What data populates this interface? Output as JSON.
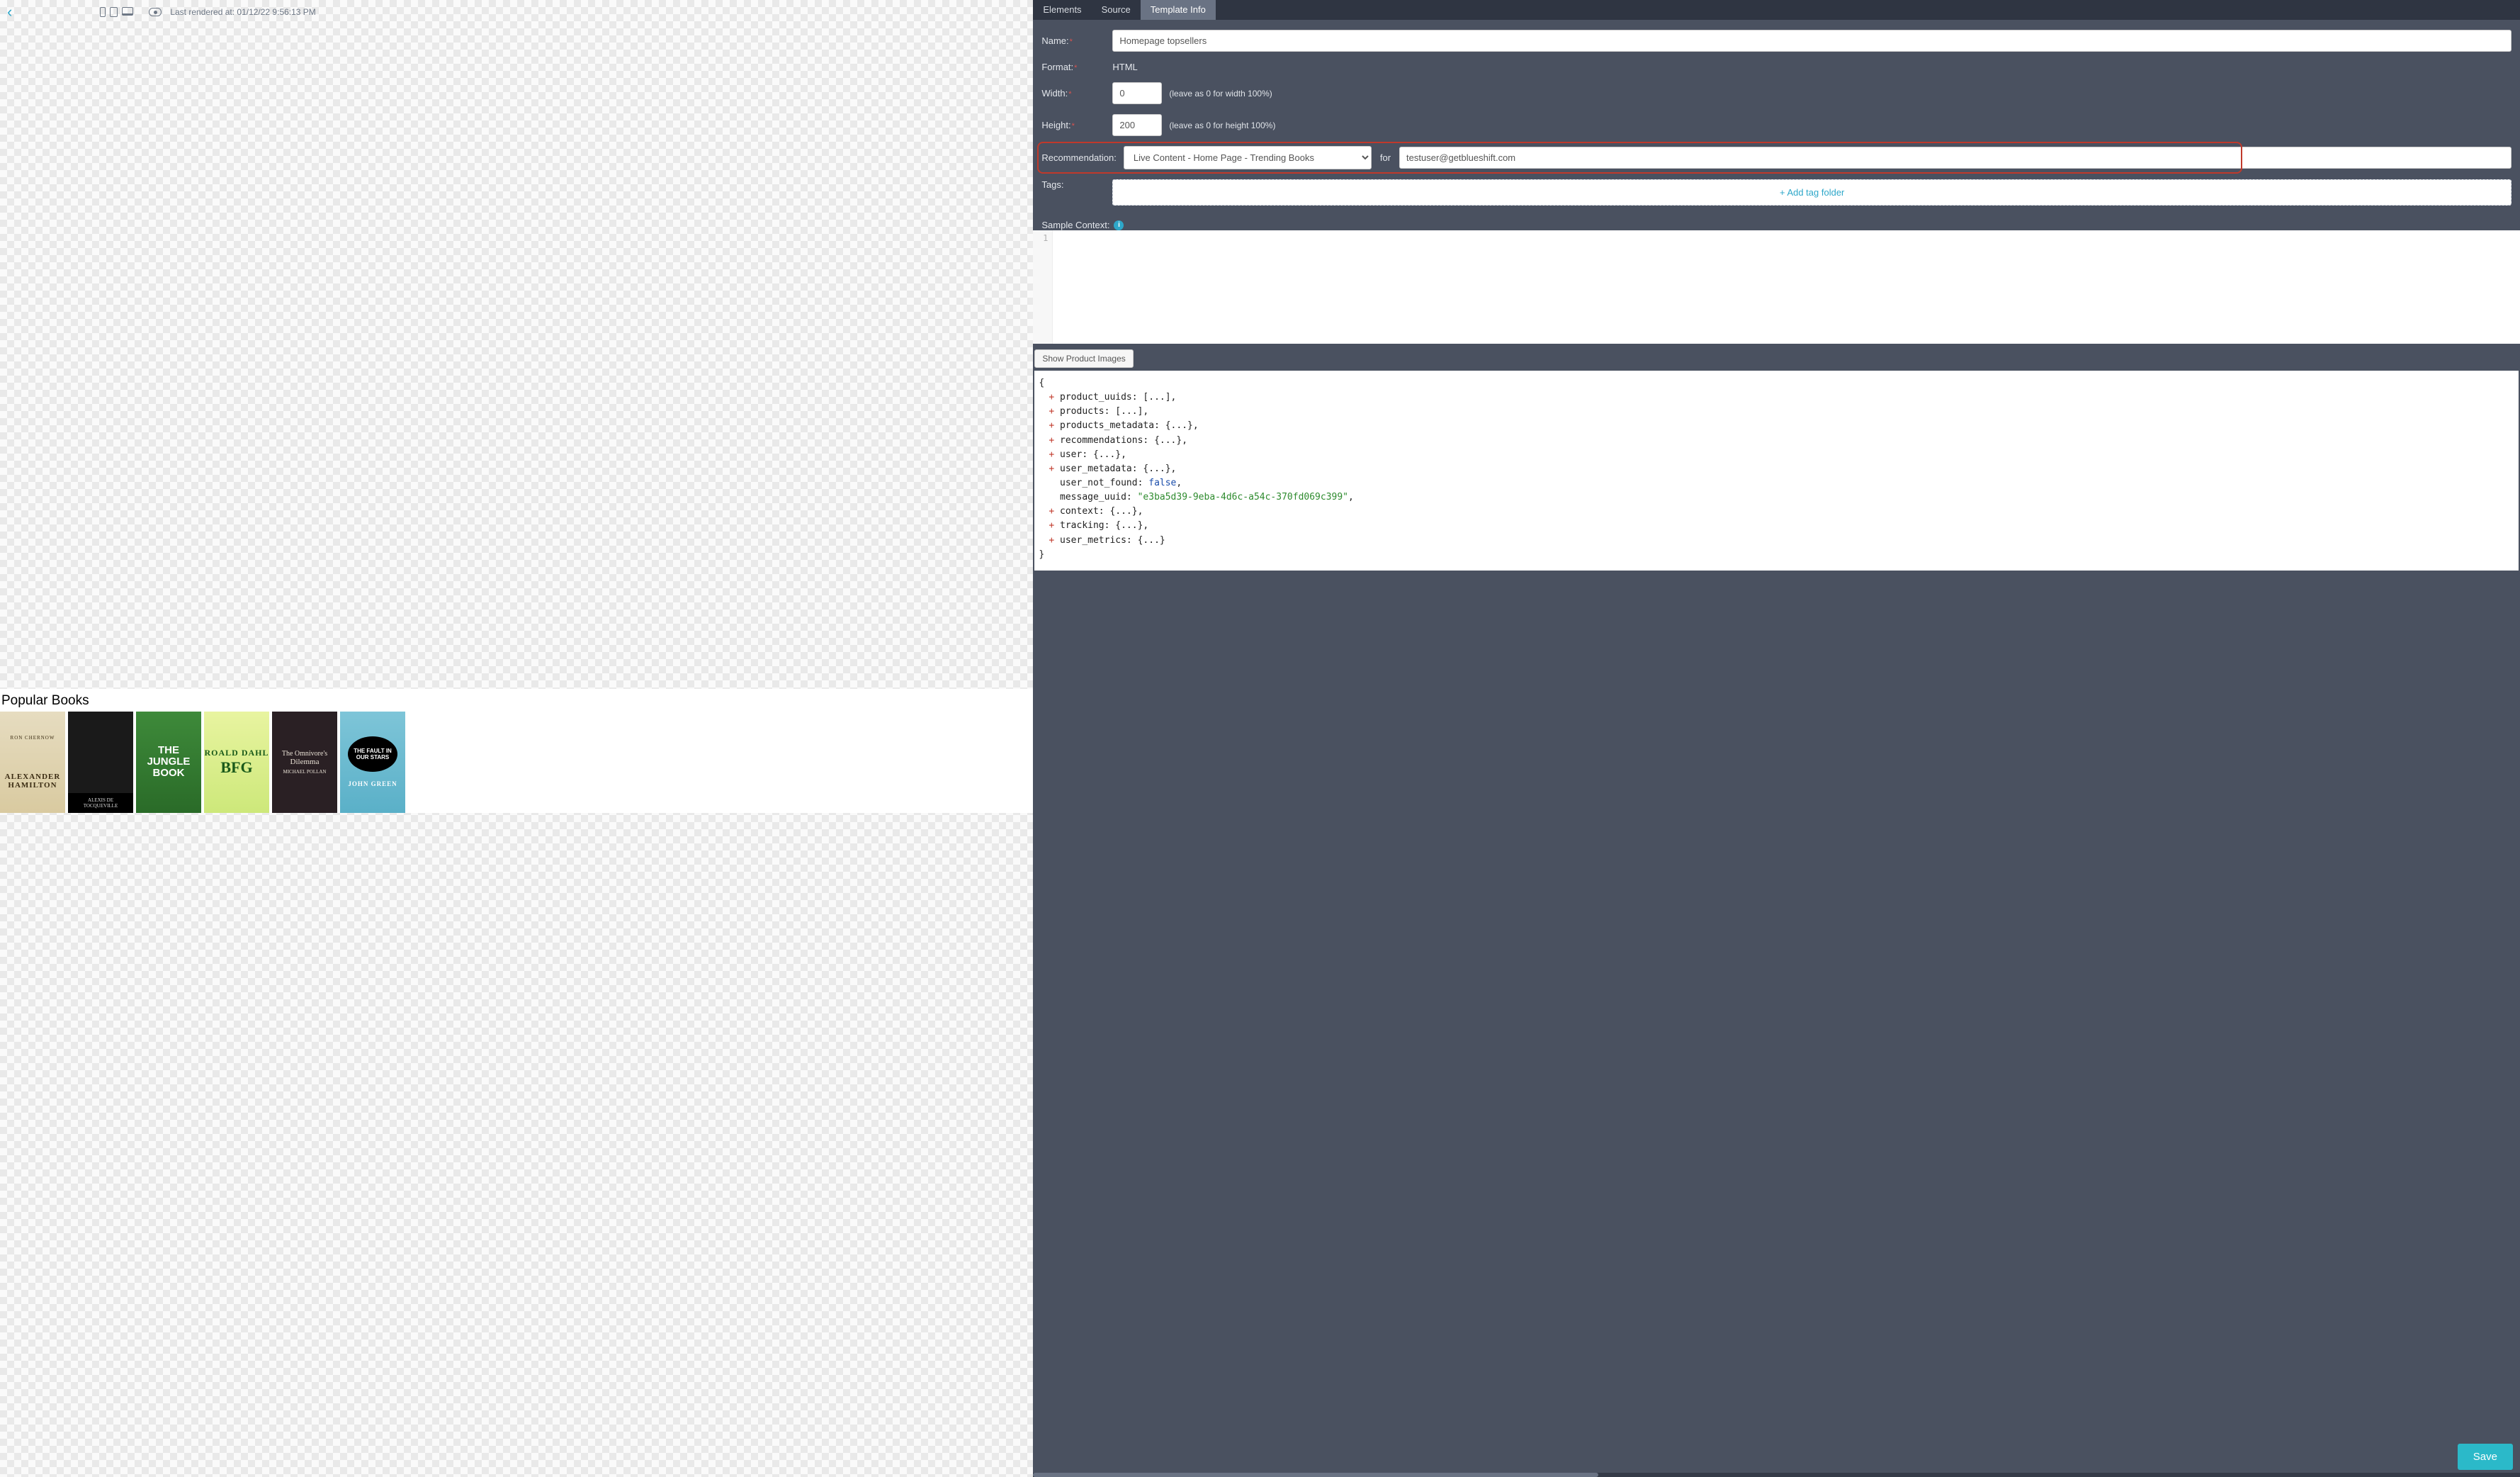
{
  "header": {
    "last_rendered_label": "Last rendered at: 01/12/22 9:56:13 PM"
  },
  "preview": {
    "title": "Popular Books",
    "books": [
      {
        "top": "RON CHERNOW",
        "title": "ALEXANDER HAMILTON"
      },
      {
        "top": "",
        "title": "ALEXIS DE TOCQUEVILLE"
      },
      {
        "top": "",
        "title": "THE JUNGLE BOOK"
      },
      {
        "top": "ROALD DAHL",
        "title": "BFG"
      },
      {
        "top": "The Omnivore's",
        "title": "Dilemma",
        "author": "MICHAEL POLLAN"
      },
      {
        "top": "THE FAULT IN OUR STARS",
        "title": "JOHN GREEN"
      }
    ]
  },
  "tabs": {
    "elements": "Elements",
    "source": "Source",
    "template_info": "Template Info"
  },
  "form": {
    "name_label": "Name:",
    "name_value": "Homepage topsellers",
    "format_label": "Format:",
    "format_value": "HTML",
    "width_label": "Width:",
    "width_value": "0",
    "width_hint": "(leave as 0 for width 100%)",
    "height_label": "Height:",
    "height_value": "200",
    "height_hint": "(leave as 0 for height 100%)",
    "rec_label": "Recommendation:",
    "rec_value": "Live Content - Home Page - Trending Books",
    "for_label": "for",
    "for_value": "testuser@getblueshift.com",
    "tags_label": "Tags:",
    "tags_add": "+ Add tag folder",
    "sample_context_label": "Sample Context:",
    "code_line1": "1",
    "show_product_images": "Show Product Images"
  },
  "json_tree": {
    "open": "{",
    "lines": [
      {
        "exp": true,
        "key": "product_uuids",
        "suffix": ": [...],"
      },
      {
        "exp": true,
        "key": "products",
        "suffix": ": [...],"
      },
      {
        "exp": true,
        "key": "products_metadata",
        "suffix": ": {...},"
      },
      {
        "exp": true,
        "key": "recommendations",
        "suffix": ": {...},"
      },
      {
        "exp": true,
        "key": "user",
        "suffix": ": {...},"
      },
      {
        "exp": true,
        "key": "user_metadata",
        "suffix": ": {...},"
      },
      {
        "exp": false,
        "key": "user_not_found",
        "suffix": ": ",
        "bool": "false",
        "tail": ","
      },
      {
        "exp": false,
        "key": "message_uuid",
        "suffix": ": ",
        "str": "\"e3ba5d39-9eba-4d6c-a54c-370fd069c399\"",
        "tail": ","
      },
      {
        "exp": true,
        "key": "context",
        "suffix": ": {...},"
      },
      {
        "exp": true,
        "key": "tracking",
        "suffix": ": {...},"
      },
      {
        "exp": true,
        "key": "user_metrics",
        "suffix": ": {...}"
      }
    ],
    "close": "}"
  },
  "footer": {
    "save": "Save"
  }
}
